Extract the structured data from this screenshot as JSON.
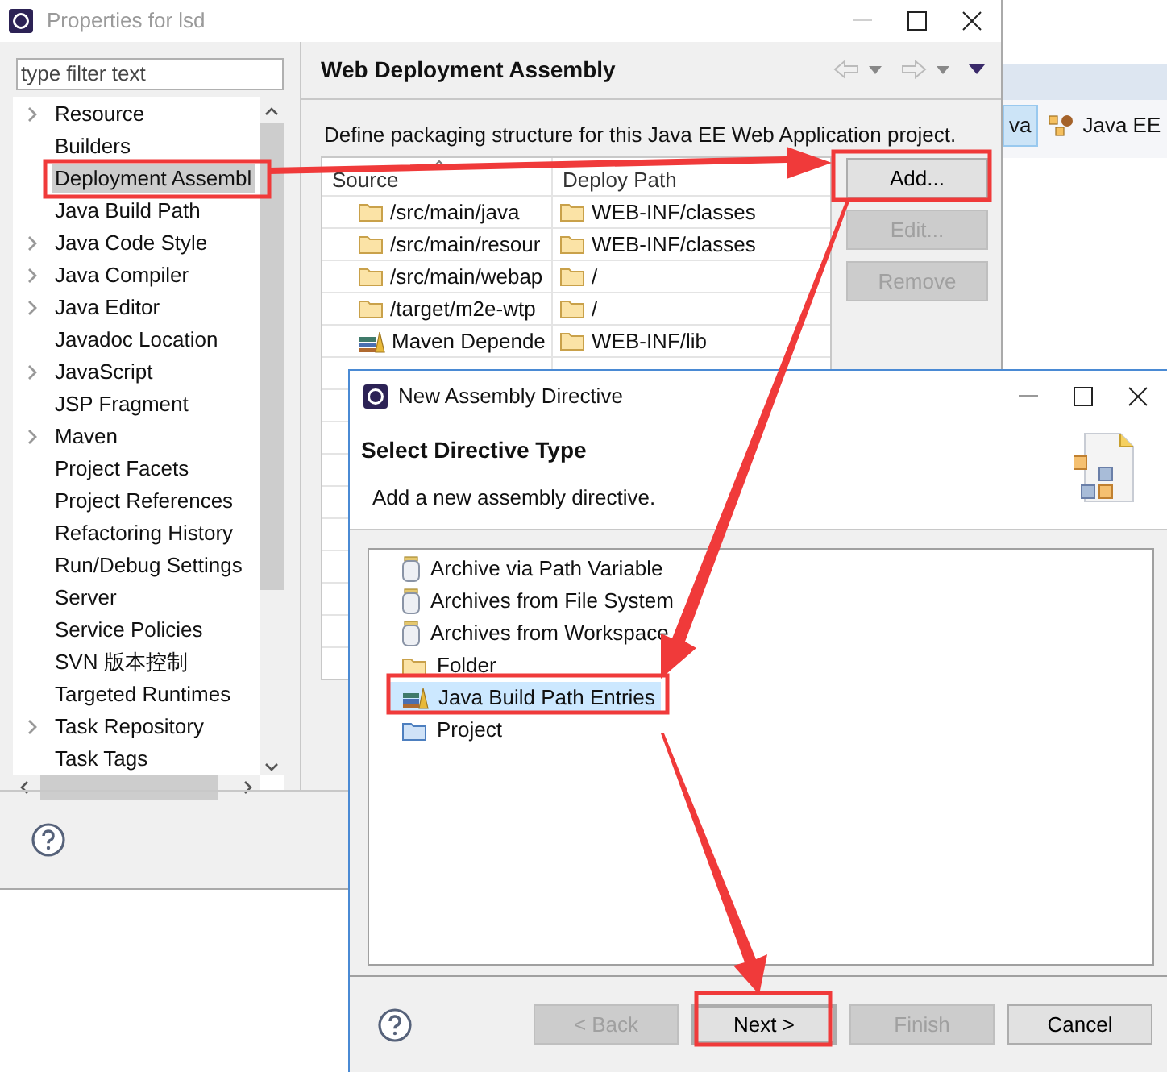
{
  "background": {
    "toolbar_items": [
      {
        "label": "va",
        "selected": true
      },
      {
        "label": "Java EE",
        "selected": false
      }
    ]
  },
  "properties_window": {
    "title": "Properties for lsd",
    "filter": {
      "placeholder": "type filter text"
    },
    "tree": [
      {
        "label": "Resource",
        "expandable": true,
        "selected": false
      },
      {
        "label": "Builders",
        "expandable": false,
        "selected": false
      },
      {
        "label": "Deployment Assembl",
        "expandable": false,
        "selected": true
      },
      {
        "label": "Java Build Path",
        "expandable": false,
        "selected": false
      },
      {
        "label": "Java Code Style",
        "expandable": true,
        "selected": false
      },
      {
        "label": "Java Compiler",
        "expandable": true,
        "selected": false
      },
      {
        "label": "Java Editor",
        "expandable": true,
        "selected": false
      },
      {
        "label": "Javadoc Location",
        "expandable": false,
        "selected": false
      },
      {
        "label": "JavaScript",
        "expandable": true,
        "selected": false
      },
      {
        "label": "JSP Fragment",
        "expandable": false,
        "selected": false
      },
      {
        "label": "Maven",
        "expandable": true,
        "selected": false
      },
      {
        "label": "Project Facets",
        "expandable": false,
        "selected": false
      },
      {
        "label": "Project References",
        "expandable": false,
        "selected": false
      },
      {
        "label": "Refactoring History",
        "expandable": false,
        "selected": false
      },
      {
        "label": "Run/Debug Settings",
        "expandable": false,
        "selected": false
      },
      {
        "label": "Server",
        "expandable": false,
        "selected": false
      },
      {
        "label": "Service Policies",
        "expandable": false,
        "selected": false
      },
      {
        "label": "SVN 版本控制",
        "expandable": false,
        "selected": false
      },
      {
        "label": "Targeted Runtimes",
        "expandable": false,
        "selected": false
      },
      {
        "label": "Task Repository",
        "expandable": true,
        "selected": false
      },
      {
        "label": "Task Tags",
        "expandable": false,
        "selected": false
      }
    ],
    "page": {
      "title": "Web Deployment Assembly",
      "description": "Define packaging structure for this Java EE Web Application project.",
      "table": {
        "columns": [
          "Source",
          "Deploy Path"
        ],
        "rows": [
          {
            "source": "/src/main/java",
            "kind": "folder",
            "deploy_path": "WEB-INF/classes"
          },
          {
            "source": "/src/main/resour",
            "kind": "folder",
            "deploy_path": "WEB-INF/classes"
          },
          {
            "source": "/src/main/webap",
            "kind": "folder",
            "deploy_path": "/"
          },
          {
            "source": "/target/m2e-wtp",
            "kind": "folder",
            "deploy_path": "/"
          },
          {
            "source": "Maven Depende",
            "kind": "library",
            "deploy_path": "WEB-INF/lib"
          }
        ]
      },
      "buttons": [
        {
          "label": "Add...",
          "disabled": false
        },
        {
          "label": "Edit...",
          "disabled": true
        },
        {
          "label": "Remove",
          "disabled": true
        }
      ]
    }
  },
  "dialog": {
    "title": "New Assembly Directive",
    "heading": "Select Directive Type",
    "description": "Add a new assembly directive.",
    "directives": [
      {
        "label": "Archive via Path Variable",
        "kind": "archive",
        "selected": false
      },
      {
        "label": "Archives from File System",
        "kind": "archive",
        "selected": false
      },
      {
        "label": "Archives from Workspace",
        "kind": "archive",
        "selected": false
      },
      {
        "label": "Folder",
        "kind": "folder",
        "selected": false
      },
      {
        "label": "Java Build Path Entries",
        "kind": "library",
        "selected": true
      },
      {
        "label": "Project",
        "kind": "project",
        "selected": false
      }
    ],
    "buttons": [
      {
        "label": "< Back",
        "disabled": true,
        "default": false
      },
      {
        "label": "Next >",
        "disabled": false,
        "default": true
      },
      {
        "label": "Finish",
        "disabled": true,
        "default": false
      },
      {
        "label": "Cancel",
        "disabled": false,
        "default": false
      }
    ]
  }
}
